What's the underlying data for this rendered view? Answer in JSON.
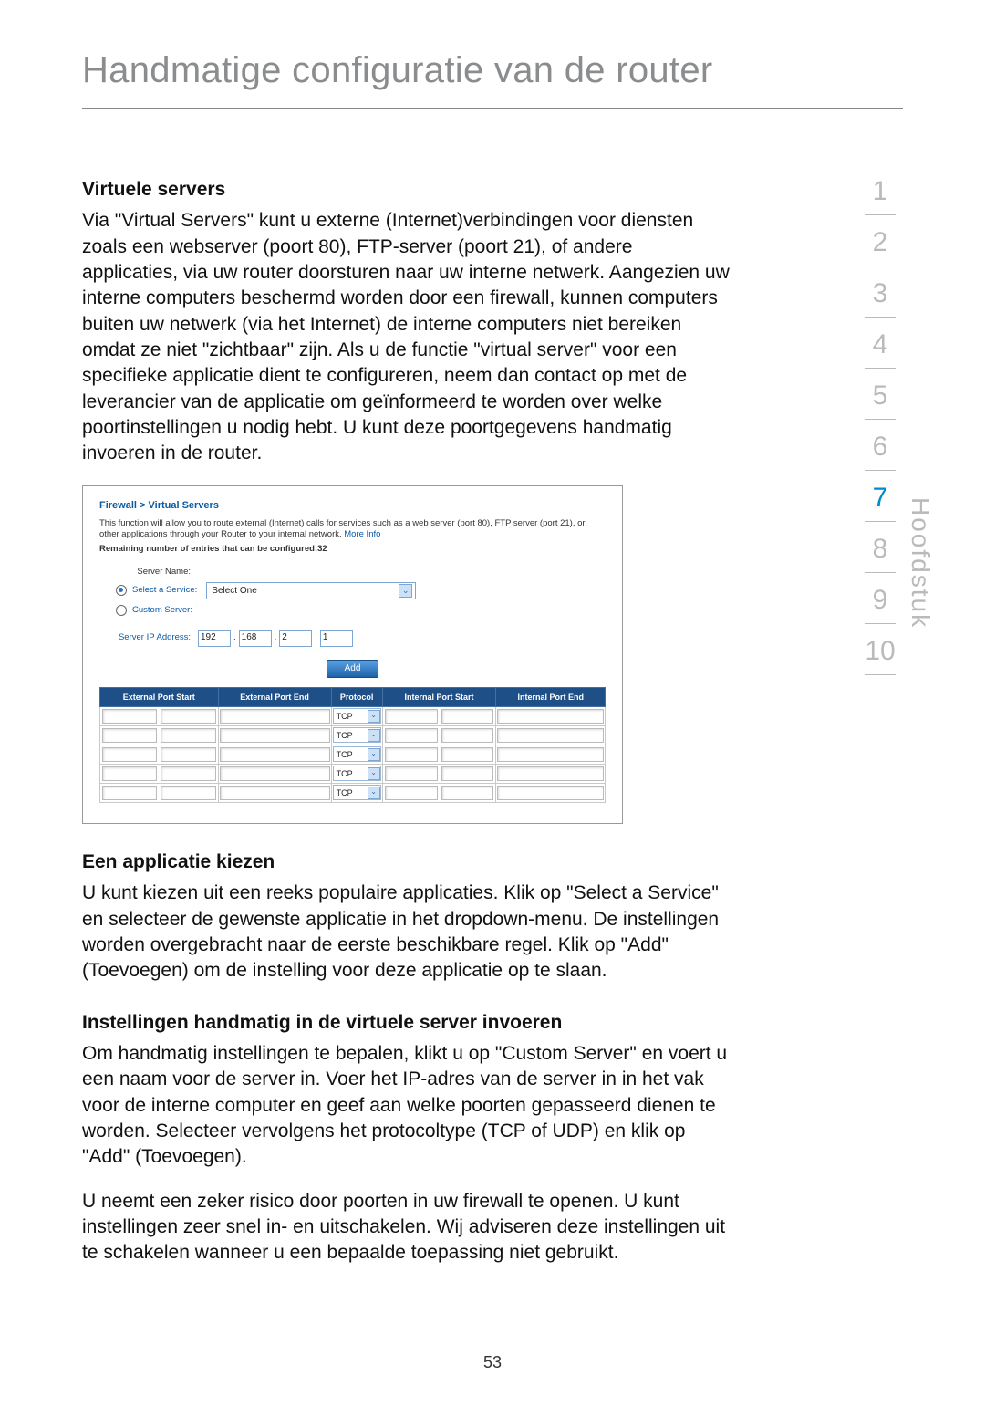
{
  "header": {
    "title": "Handmatige configuratie van de router"
  },
  "sidebar": {
    "items": [
      "1",
      "2",
      "3",
      "4",
      "5",
      "6",
      "7",
      "8",
      "9",
      "10"
    ],
    "active": "7",
    "label": "Hoofdstuk"
  },
  "section1": {
    "title": "Virtuele servers",
    "body": "Via \"Virtual Servers\" kunt u externe (Internet)verbindingen voor diensten zoals een webserver (poort 80), FTP-server (poort 21), of andere applicaties, via uw router doorsturen naar uw interne netwerk. Aangezien uw interne computers beschermd worden door een firewall, kunnen computers buiten uw netwerk (via het Internet) de interne computers niet bereiken omdat ze niet \"zichtbaar\" zijn. Als u de functie \"virtual server\" voor een specifieke applicatie dient te configureren, neem dan contact op met de leverancier van de applicatie om geïnformeerd te worden over welke poortinstellingen u nodig hebt. U kunt deze poortgegevens handmatig invoeren in de router."
  },
  "router_ui": {
    "crumb": "Firewall > Virtual Servers",
    "desc": "This function will allow you to route external (Internet) calls for services such as a web server (port 80), FTP server (port 21), or other applications through your Router to your internal network. ",
    "more_info": "More Info",
    "remaining": "Remaining number of entries that can be configured:32",
    "server_name_label": "Server Name:",
    "select_service_label": "Select a Service:",
    "select_service_value": "Select One",
    "custom_server_label": "Custom Server:",
    "ip_label": "Server IP Address:",
    "ip": [
      "192",
      "168",
      "2",
      "1"
    ],
    "add_button": "Add",
    "headers": [
      "External Port Start",
      "External Port End",
      "Protocol",
      "Internal Port Start",
      "Internal Port End"
    ],
    "rows": 5,
    "protocol_value": "TCP"
  },
  "section2": {
    "title": "Een applicatie kiezen",
    "body": "U kunt kiezen uit een reeks populaire applicaties. Klik op \"Select a Service\" en selecteer de gewenste applicatie in het dropdown-menu. De instellingen worden overgebracht naar de eerste beschikbare regel. Klik op \"Add\" (Toevoegen) om de instelling voor deze applicatie op te slaan."
  },
  "section3": {
    "title": "Instellingen handmatig in de virtuele server invoeren",
    "body1": "Om handmatig instellingen te bepalen, klikt u op \"Custom Server\" en voert u een naam voor de server in. Voer het IP-adres van de server in in het vak voor de interne computer en geef aan welke poorten gepasseerd dienen te worden. Selecteer vervolgens het protocoltype (TCP of UDP) en klik op \"Add\" (Toevoegen).",
    "body2": "U neemt een zeker risico door poorten in uw firewall te openen. U kunt instellingen zeer snel in- en uitschakelen. Wij adviseren deze instellingen uit te schakelen wanneer u een bepaalde toepassing niet gebruikt."
  },
  "page_number": "53"
}
